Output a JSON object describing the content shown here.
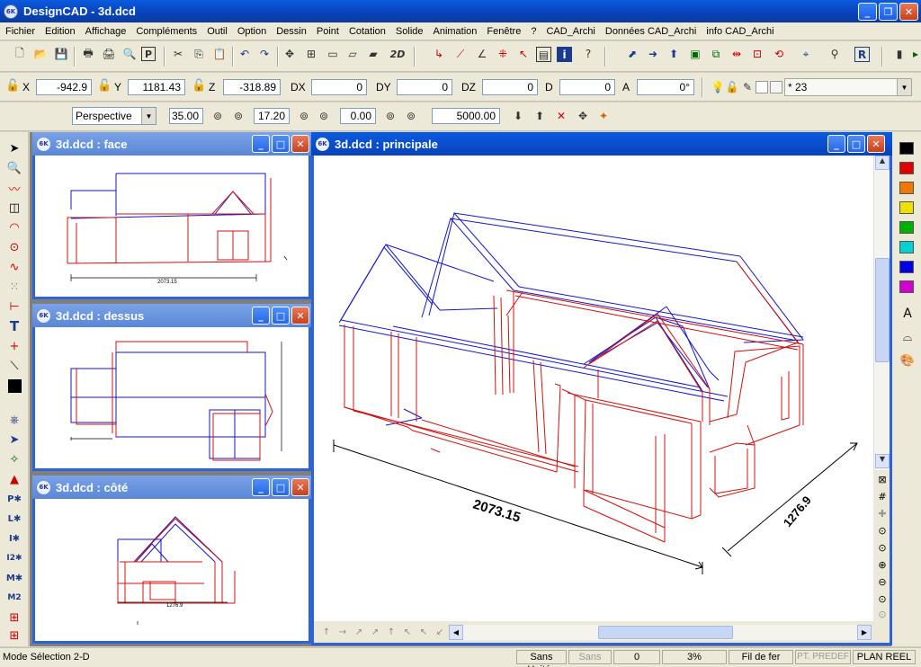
{
  "app": {
    "title": "DesignCAD - 3d.dcd",
    "icon_text": "6K"
  },
  "menu": [
    "Fichier",
    "Edition",
    "Affichage",
    "Compléments",
    "Outil",
    "Option",
    "Dessin",
    "Point",
    "Cotation",
    "Solide",
    "Animation",
    "Fenêtre",
    "?",
    "CAD_Archi",
    "Données CAD_Archi",
    "info CAD_Archi"
  ],
  "toolbar": {
    "btn_2d": "2D",
    "btn_r": "R"
  },
  "coords": {
    "x_label": "X",
    "x_value": "-942.9",
    "y_label": "Y",
    "y_value": "1181.43",
    "z_label": "Z",
    "z_value": "-318.89",
    "dx_label": "DX",
    "dx_value": "0",
    "dy_label": "DY",
    "dy_value": "0",
    "dz_label": "DZ",
    "dz_value": "0",
    "d_label": "D",
    "d_value": "0",
    "a_label": "A",
    "a_value": "0°",
    "layer_value": "* 23"
  },
  "view": {
    "mode": "Perspective",
    "v1": "35.00",
    "v2": "17.20",
    "v3": "0.00",
    "v4": "5000.00"
  },
  "windows": {
    "face": "3d.dcd : face",
    "dessus": "3d.dcd : dessus",
    "cote": "3d.dcd : côté",
    "principale": "3d.dcd : principale"
  },
  "dims": {
    "face": "2073.15",
    "cote": "1276.9",
    "main_length": "2073.15",
    "main_depth": "1276.9"
  },
  "colors": {
    "palette": [
      "#000000",
      "#e00000",
      "#f07800",
      "#f0e000",
      "#00b000",
      "#00d0d0",
      "#0000e0",
      "#d000d0"
    ],
    "wire_blue": "#1515c8",
    "wire_red": "#d01010",
    "titlebar": "#0a5be0"
  },
  "status": {
    "mode": "Mode Sélection 2-D",
    "units": "Sans Unités",
    "font": "Sans",
    "count": "0",
    "zoom": "3%",
    "render": "Fil de fer",
    "pt": "PT. PREDEF",
    "plan": "PLAN REEL"
  }
}
